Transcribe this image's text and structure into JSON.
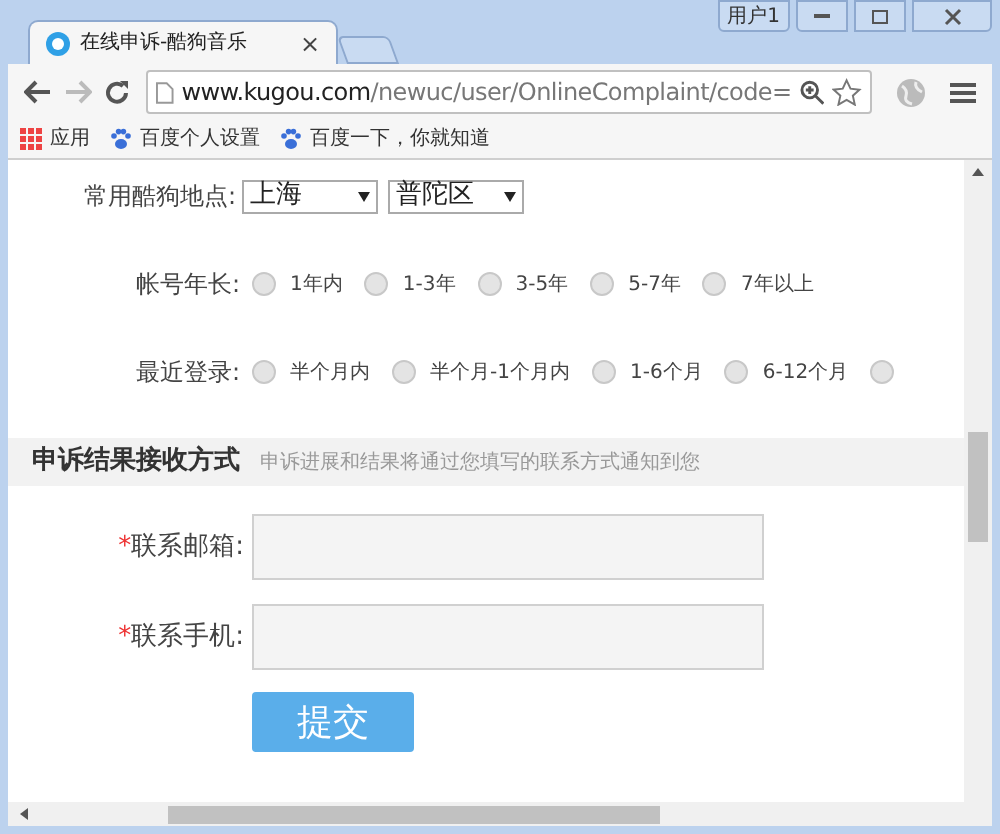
{
  "window": {
    "user_badge": "用户1"
  },
  "tabs": [
    {
      "title": "在线申诉-酷狗音乐",
      "close": "×",
      "selected": true
    }
  ],
  "address_bar": {
    "url_host": "www.kugou.com",
    "url_path": "/newuc/user/OnlineComplaint/code="
  },
  "bookmarks": [
    {
      "label": "应用",
      "kind": "apps"
    },
    {
      "label": "百度个人设置",
      "kind": "paw"
    },
    {
      "label": "百度一下，你就知道",
      "kind": "paw"
    }
  ],
  "location": {
    "label": "常用酷狗地点:",
    "selects": [
      {
        "value": "上海"
      },
      {
        "value": "普陀区"
      }
    ]
  },
  "radio_groups": [
    {
      "label": "帐号年长:",
      "options": [
        {
          "label": "1年内",
          "selected": false
        },
        {
          "label": "1-3年",
          "selected": false
        },
        {
          "label": "3-5年",
          "selected": false
        },
        {
          "label": "5-7年",
          "selected": false
        },
        {
          "label": "7年以上",
          "selected": false
        }
      ]
    },
    {
      "label": "最近登录:",
      "options": [
        {
          "label": "半个月内",
          "selected": false
        },
        {
          "label": "半个月-1个月内",
          "selected": false
        },
        {
          "label": "1-6个月",
          "selected": false
        },
        {
          "label": "6-12个月",
          "selected": false
        },
        {
          "selected": false
        }
      ]
    }
  ],
  "section": {
    "title": "申诉结果接收方式",
    "note": "申诉进展和结果将通过您填写的联系方式通知到您"
  },
  "fields": [
    {
      "required": "*",
      "label": "联系邮箱:"
    },
    {
      "required": "*",
      "label": "联系手机:"
    }
  ],
  "submit": "提交"
}
